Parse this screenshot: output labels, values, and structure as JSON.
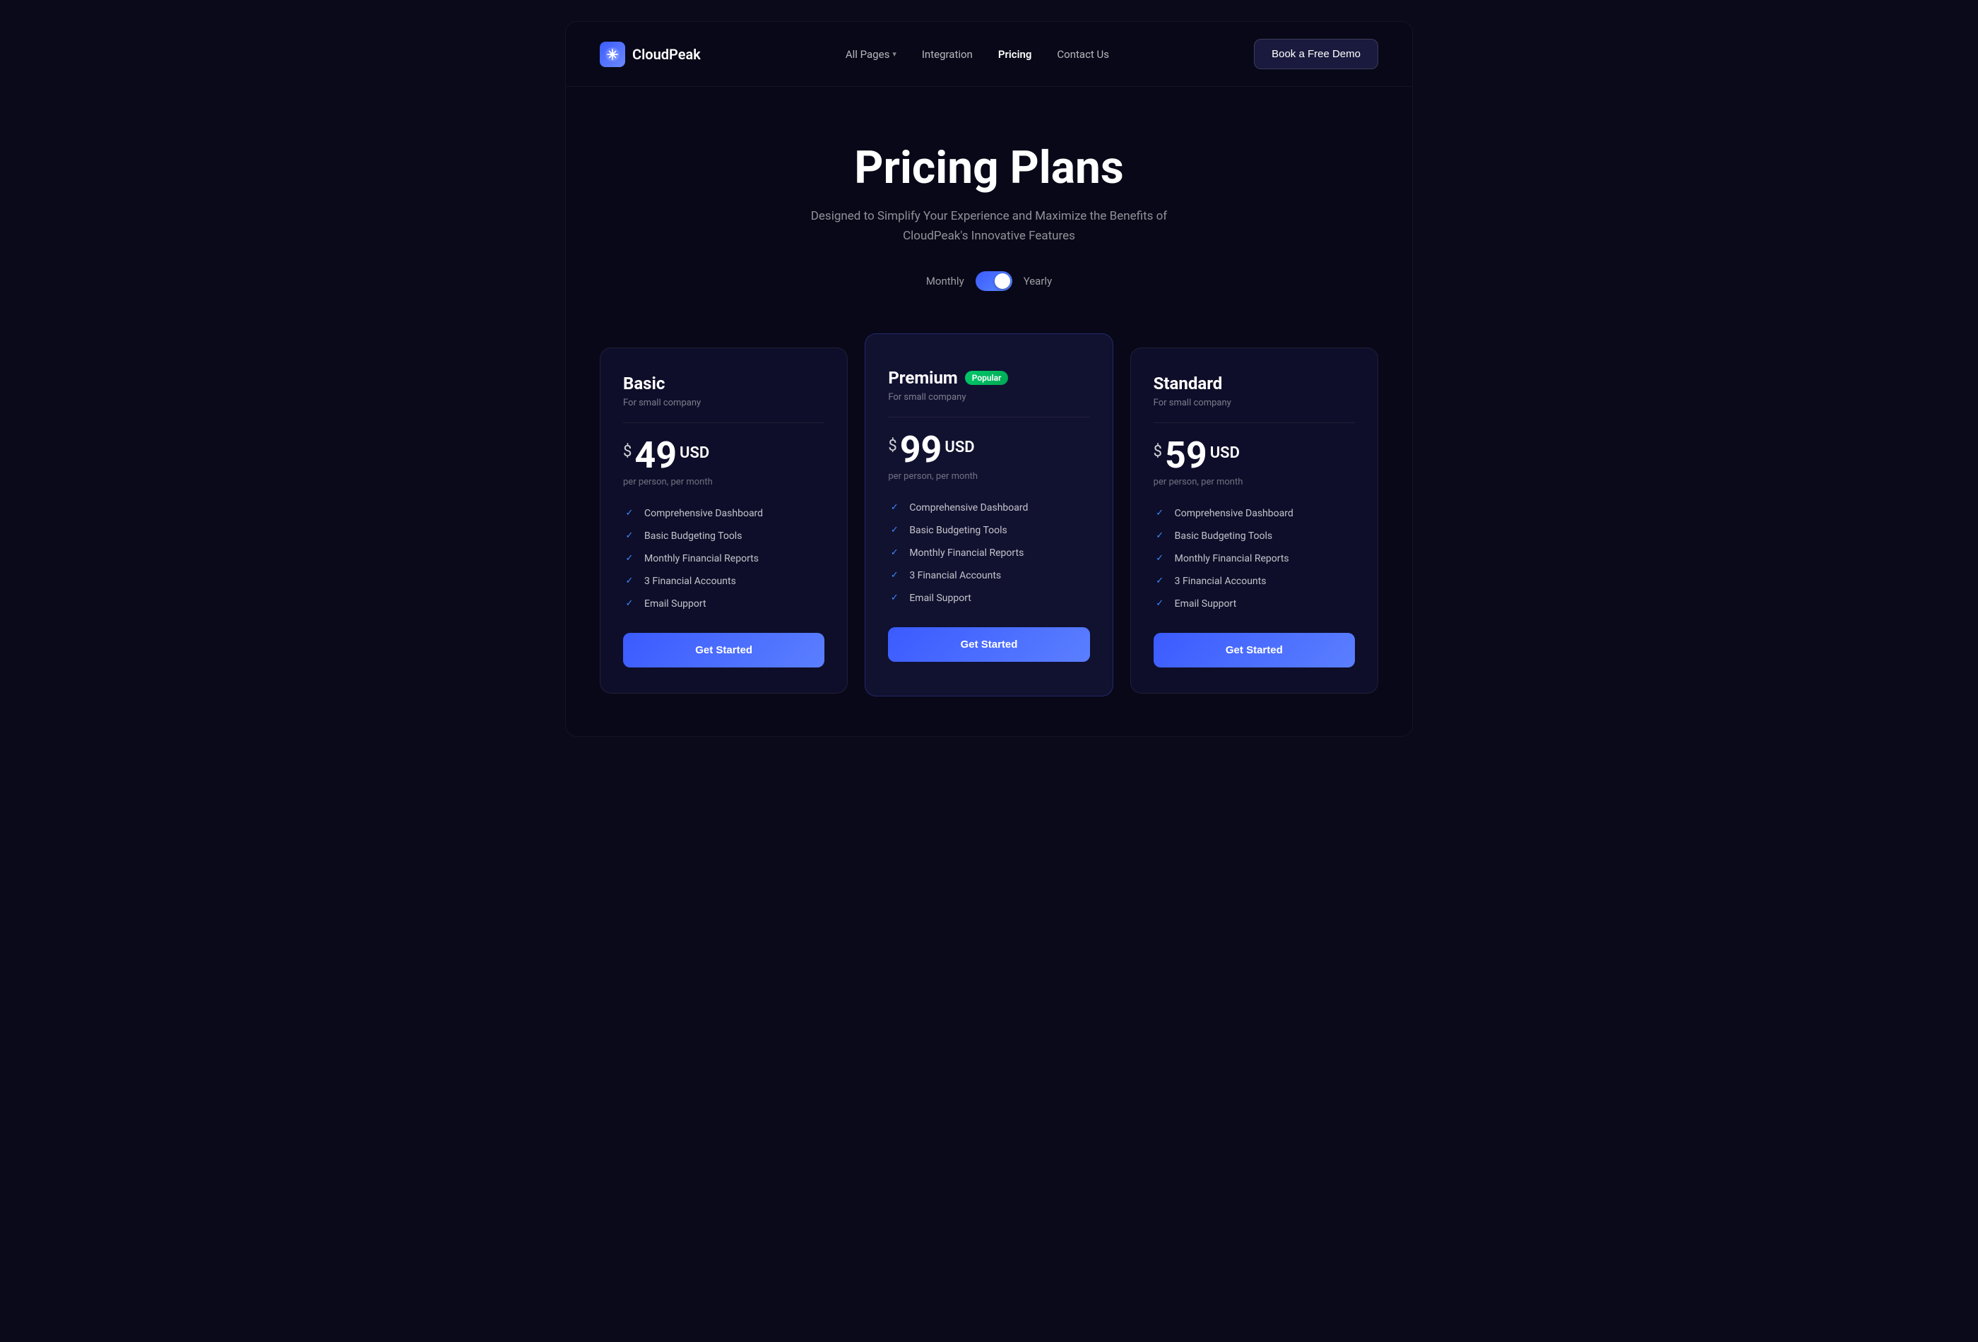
{
  "brand": {
    "name": "CloudPeak",
    "logo_emoji": "❄"
  },
  "nav": {
    "links": [
      {
        "label": "All Pages",
        "has_dropdown": true,
        "active": false
      },
      {
        "label": "Integration",
        "has_dropdown": false,
        "active": false
      },
      {
        "label": "Pricing",
        "has_dropdown": false,
        "active": true
      },
      {
        "label": "Contact Us",
        "has_dropdown": false,
        "active": false
      }
    ],
    "cta_label": "Book a Free Demo"
  },
  "hero": {
    "title": "Pricing Plans",
    "subtitle": "Designed to Simplify Your Experience and Maximize the Benefits of CloudPeak's Innovative Features",
    "billing_toggle": {
      "monthly_label": "Monthly",
      "yearly_label": "Yearly",
      "active": "yearly"
    }
  },
  "plans": [
    {
      "id": "basic",
      "name": "Basic",
      "subtitle": "For small company",
      "popular": false,
      "price": "49",
      "currency": "USD",
      "currency_sign": "$",
      "period": "per person, per month",
      "features": [
        "Comprehensive Dashboard",
        "Basic Budgeting Tools",
        "Monthly Financial Reports",
        "3 Financial Accounts",
        "Email Support"
      ],
      "cta": "Get Started"
    },
    {
      "id": "premium",
      "name": "Premium",
      "subtitle": "For small company",
      "popular": true,
      "popular_label": "Popular",
      "price": "99",
      "currency": "USD",
      "currency_sign": "$",
      "period": "per person, per month",
      "features": [
        "Comprehensive Dashboard",
        "Basic Budgeting Tools",
        "Monthly Financial Reports",
        "3 Financial Accounts",
        "Email Support"
      ],
      "cta": "Get Started"
    },
    {
      "id": "standard",
      "name": "Standard",
      "subtitle": "For small company",
      "popular": false,
      "price": "59",
      "currency": "USD",
      "currency_sign": "$",
      "period": "per person, per month",
      "features": [
        "Comprehensive Dashboard",
        "Basic Budgeting Tools",
        "Monthly Financial Reports",
        "3 Financial Accounts",
        "Email Support"
      ],
      "cta": "Get Started"
    }
  ]
}
